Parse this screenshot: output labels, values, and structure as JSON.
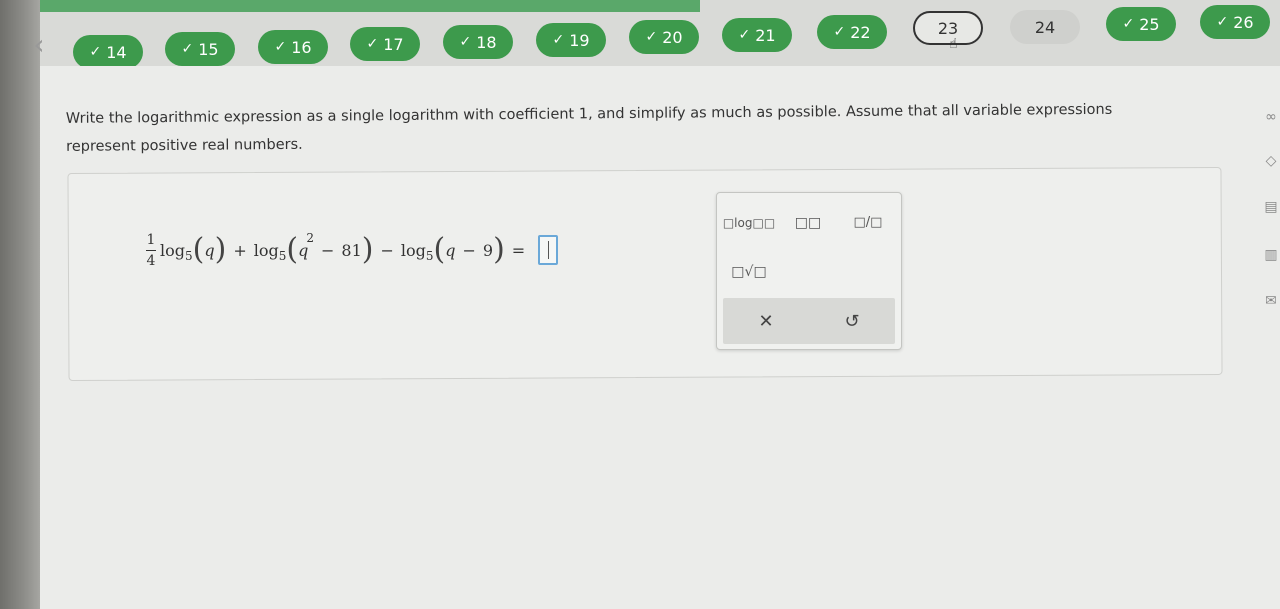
{
  "nav": {
    "questions": [
      {
        "num": "14",
        "done": true
      },
      {
        "num": "15",
        "done": true
      },
      {
        "num": "16",
        "done": true
      },
      {
        "num": "17",
        "done": true
      },
      {
        "num": "18",
        "done": true
      },
      {
        "num": "19",
        "done": true
      },
      {
        "num": "20",
        "done": true
      },
      {
        "num": "21",
        "done": true
      },
      {
        "num": "22",
        "done": true
      },
      {
        "num": "23",
        "done": false,
        "current": true
      },
      {
        "num": "24",
        "done": false
      },
      {
        "num": "25",
        "done": true
      },
      {
        "num": "26",
        "done": true
      }
    ],
    "check_glyph": "✓",
    "back_glyph": "‹"
  },
  "problem": {
    "instructions": "Write the logarithmic expression as a single logarithm with coefficient 1, and simplify as much as possible. Assume that all variable expressions represent positive real numbers."
  },
  "expression": {
    "coef_num": "1",
    "coef_den": "4",
    "log": "log",
    "base": "5",
    "var": "q",
    "exponent": "2",
    "minus": "−",
    "plus": "+",
    "equals": "=",
    "const81": "81",
    "const9": "9"
  },
  "palette": {
    "log_button": "□log□□",
    "power_button": "□□",
    "fraction_button": "□/□",
    "root_button": "□√□",
    "clear_glyph": "✕",
    "undo_glyph": "↺"
  },
  "colors": {
    "done": "#3d9a4c",
    "answer_border": "#6aa8d8"
  }
}
